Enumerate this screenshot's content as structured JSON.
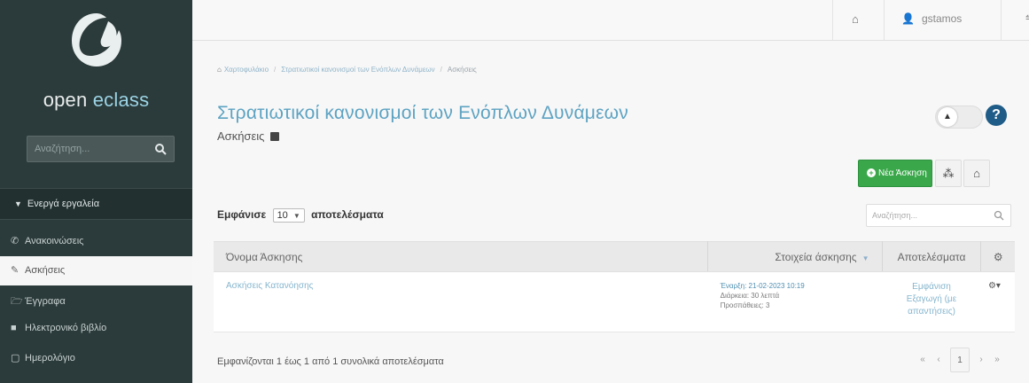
{
  "app": {
    "logo_text_prefix": "open ",
    "logo_text_accent": "eclass",
    "colors": {
      "sidebar_bg": "#2b3a3a",
      "title": "#5ea3c2",
      "button_green": "#3aa84a",
      "link": "#86b6ce"
    }
  },
  "sidebar": {
    "search_placeholder": "Αναζήτηση...",
    "section_header": "Ενεργά εργαλεία",
    "items": [
      {
        "label": "Ανακοινώσεις",
        "icon": "bullhorn-icon",
        "active": false
      },
      {
        "label": "Ασκήσεις",
        "icon": "edit-icon",
        "active": true
      },
      {
        "label": "Έγγραφα",
        "icon": "folder-open-icon",
        "active": false
      },
      {
        "label": "Ηλεκτρονικό βιβλίο",
        "icon": "book-icon",
        "active": false
      },
      {
        "label": "Ημερολόγιο",
        "icon": "calendar-icon",
        "active": false
      }
    ]
  },
  "topbar": {
    "home_icon": "home-icon",
    "username": "gstamos"
  },
  "breadcrumb": {
    "items": [
      "Χαρτοφυλάκιο",
      "Στρατιωτικοί κανονισμοί των Ενόπλων Δυνάμεων",
      "Ασκήσεις"
    ]
  },
  "page": {
    "course_title": "Στρατιωτικοί κανονισμοί των Ενόπλων Δυνάμεων",
    "subtitle": "Ασκήσεις",
    "help": "?"
  },
  "actions": {
    "new_exercise": "Νέα Άσκηση"
  },
  "table_controls": {
    "show_prefix": "Εμφάνισε",
    "page_size": "10",
    "show_suffix": "αποτελέσματα",
    "search_placeholder": "Αναζήτηση..."
  },
  "table": {
    "headers": [
      "Όνομα Άσκησης",
      "Στοιχεία άσκησης",
      "Αποτελέσματα"
    ],
    "rows": [
      {
        "name": "Ασκήσεις Κατανόησης",
        "details_start": "Έναρξη: 21-02-2023 10:19",
        "details_duration": "Διάρκεια: 30 λεπτά",
        "details_attempts": "Προσπάθειες: 3",
        "results_line1": "Εμφάνιση",
        "results_line2": "Εξαγωγή (με",
        "results_line3": "απαντήσεις)"
      }
    ]
  },
  "footer": {
    "info": "Εμφανίζονται 1 έως 1 από 1 συνολικά αποτελέσματα",
    "current_page": "1"
  }
}
